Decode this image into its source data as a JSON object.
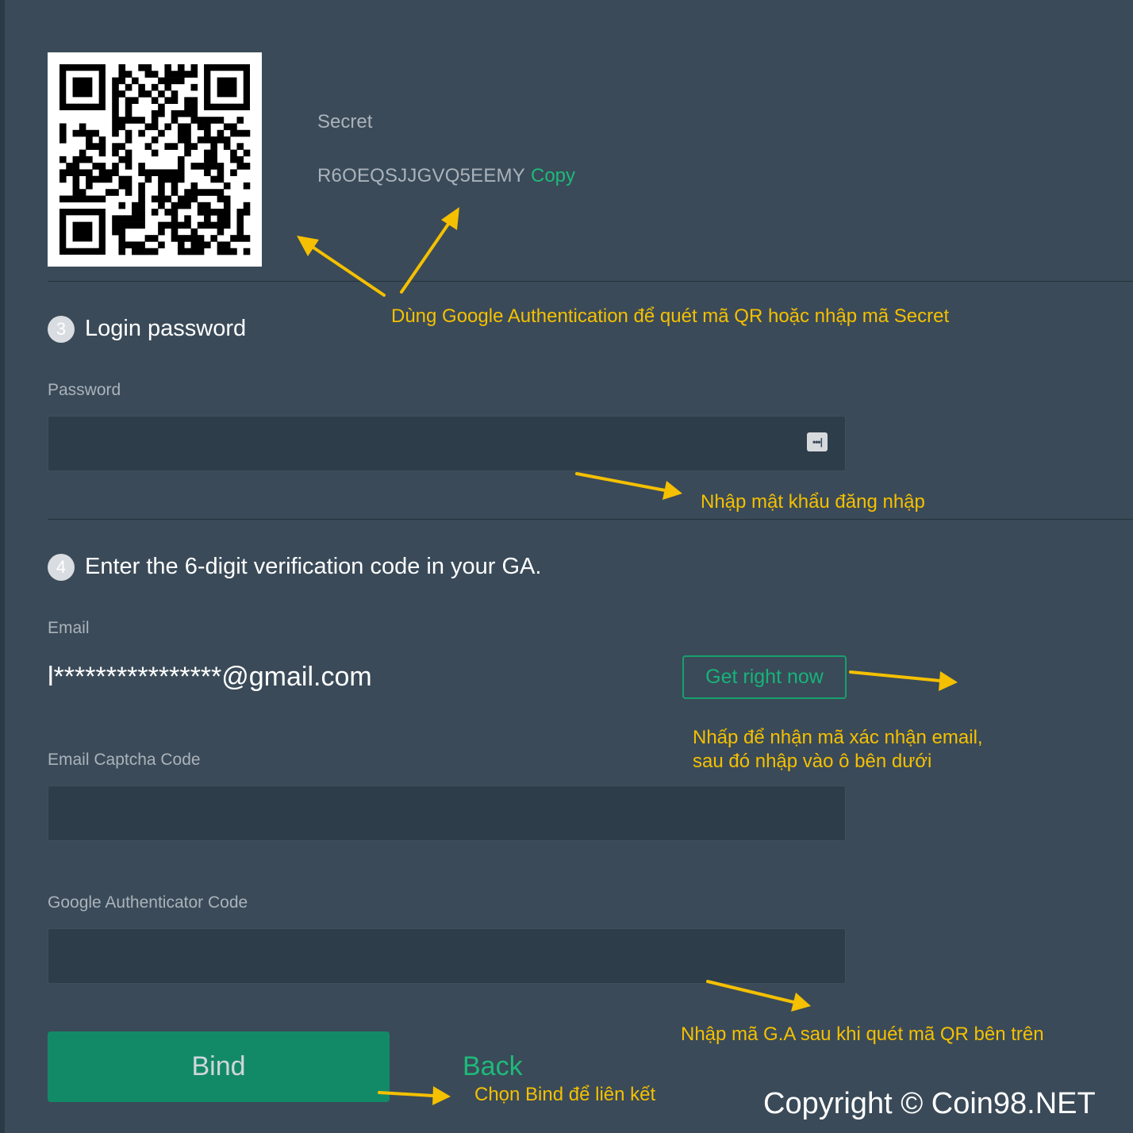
{
  "qr": {
    "alt": "QR code"
  },
  "secret": {
    "label": "Secret",
    "value": "R6OEQSJJGVQ5EEMY",
    "copy_label": "Copy"
  },
  "step3": {
    "number": "3",
    "title": "Login password",
    "password_label": "Password",
    "password_icon": "password-manager-icon"
  },
  "step4": {
    "number": "4",
    "title": "Enter the 6-digit verification code in your GA.",
    "email_label": "Email",
    "email_value": "l****************@gmail.com",
    "get_button": "Get right now",
    "email_captcha_label": "Email Captcha Code",
    "ga_code_label": "Google Authenticator Code"
  },
  "actions": {
    "bind_label": "Bind",
    "back_label": "Back"
  },
  "annotations": {
    "qr_hint": "Dùng Google Authentication để quét mã QR hoặc nhập mã Secret",
    "password_hint": "Nhập mật khẩu đăng nhập",
    "email_hint_line1": "Nhấp để nhận mã xác nhận email,",
    "email_hint_line2": "sau đó nhập vào ô bên dưới",
    "ga_hint": "Nhập mã G.A sau khi quét mã QR bên trên",
    "bind_hint": "Chọn Bind để liên kết"
  },
  "copyright": "Copyright © Coin98.NET",
  "colors": {
    "background": "#3a4a58",
    "accent_green": "#1fb97a",
    "button_green": "#138a67",
    "annotation_yellow": "#f5c000",
    "muted_text": "#aab3bb"
  }
}
